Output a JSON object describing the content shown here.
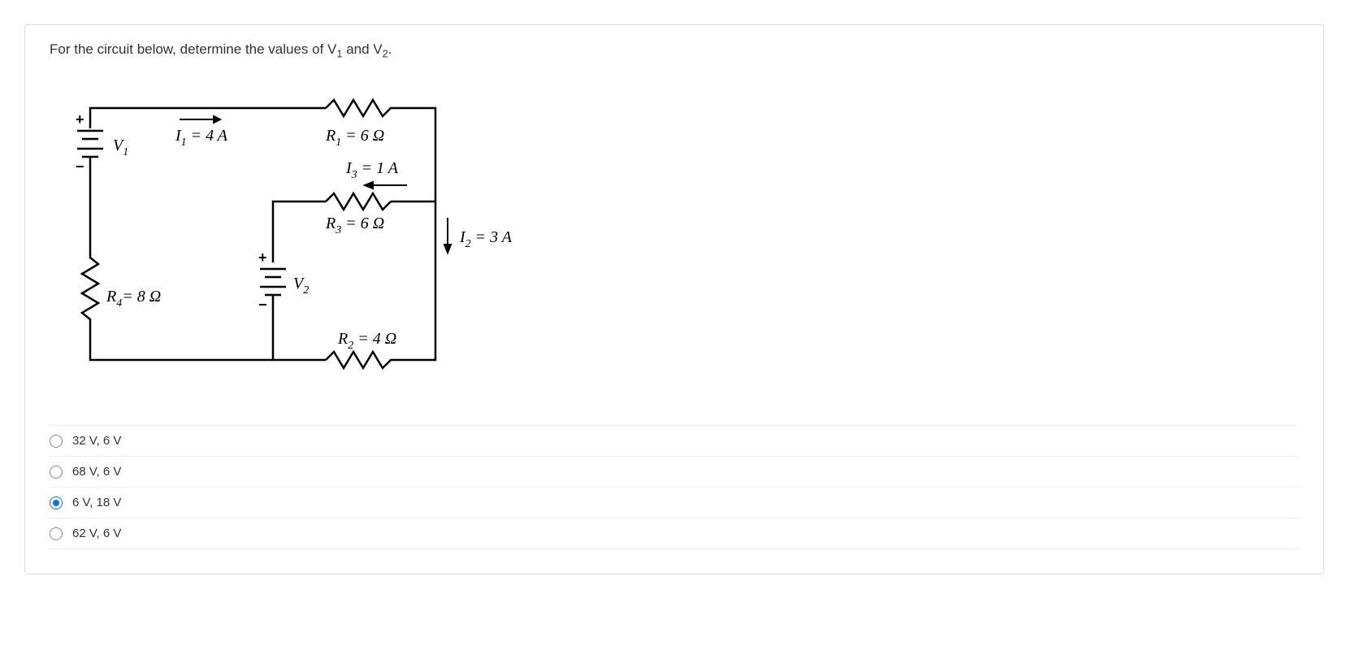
{
  "question": {
    "prefix": "For the circuit below, determine the values of V",
    "sub1": "1",
    "mid": " and V",
    "sub2": "2",
    "suffix": "."
  },
  "circuit": {
    "I1_label": "I",
    "I1_sub": "1",
    "I1_value": " = 4 A",
    "R1_label": "R",
    "R1_sub": "1",
    "R1_value": " = 6 Ω",
    "I3_label": "I",
    "I3_sub": "3",
    "I3_value": " = 1 A",
    "R3_label": "R",
    "R3_sub": "3",
    "R3_value": " = 6 Ω",
    "I2_label": "I",
    "I2_sub": "2",
    "I2_value": " = 3 A",
    "R4_label": "R",
    "R4_sub": "4",
    "R4_value": "= 8 Ω",
    "R2_label": "R",
    "R2_sub": "2",
    "R2_value": " = 4 Ω",
    "V1_label": "V",
    "V1_sub": "1",
    "V2_label": "V",
    "V2_sub": "2",
    "plus": "+",
    "minus": "−"
  },
  "options": [
    {
      "label": "32 V, 6 V",
      "selected": false
    },
    {
      "label": "68 V, 6 V",
      "selected": false
    },
    {
      "label": "6 V, 18 V",
      "selected": true
    },
    {
      "label": "62 V, 6 V",
      "selected": false
    }
  ]
}
